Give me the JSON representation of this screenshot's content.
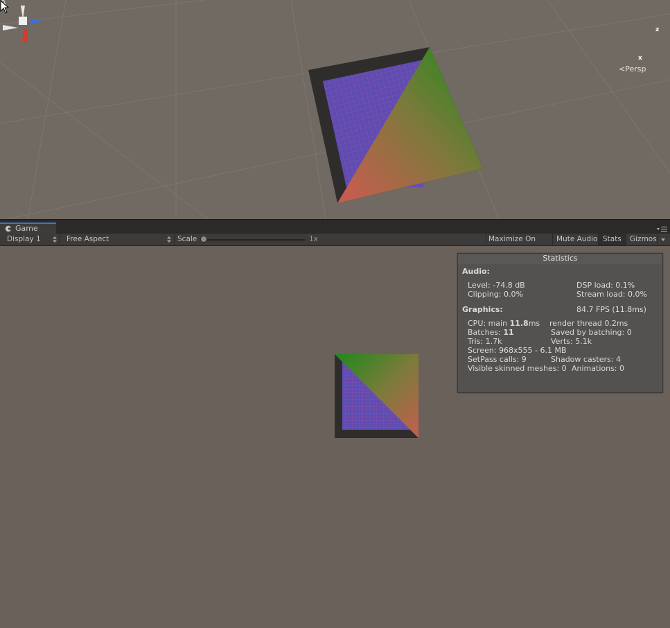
{
  "scene": {
    "persp_label": "Persp",
    "gizmo_axis_z": "z",
    "gizmo_axis_x": "x",
    "icons": [
      "lock-icon",
      "scene-gizmo-icon",
      "mouse-cursor-icon"
    ]
  },
  "tabs": [
    {
      "label": "Game",
      "icon": "game-controller-icon",
      "active": true
    }
  ],
  "toolbar": {
    "display": "Display 1",
    "aspect": "Free Aspect",
    "scale_label": "Scale",
    "scale_value": "1x",
    "scale_slider_fraction": 0,
    "maximize_on_play": "Maximize On Play",
    "mute_audio": "Mute Audio",
    "stats": "Stats",
    "gizmos": "Gizmos"
  },
  "stats": {
    "title": "Statistics",
    "audio_heading": "Audio:",
    "level": "Level: -74.8 dB",
    "dsp_load": "DSP load: 0.1%",
    "clipping": "Clipping: 0.0%",
    "stream_load": "Stream load: 0.0%",
    "graphics_heading": "Graphics:",
    "fps": "84.7 FPS (11.8ms)",
    "cpu_prefix": "CPU: main ",
    "cpu_main": "11.8",
    "cpu_unit": "ms",
    "render_thread": "render thread 0.2ms",
    "batches_prefix": "Batches: ",
    "batches": "11",
    "saved_by_batching": "Saved by batching: 0",
    "tris": "Tris: 1.7k",
    "verts": "Verts: 5.1k",
    "screen": "Screen: 968x555 - 6.1 MB",
    "setpass": "SetPass calls: 9",
    "shadow_casters": "Shadow casters: 4",
    "visible_skinned": "Visible skinned meshes: 0",
    "animations": "Animations: 0"
  },
  "colors": {
    "scene_bg": "#706a63",
    "game_bg": "#6a615b",
    "toolbar_bg": "#3c3b3a",
    "tab_accent": "#3a78c0",
    "quad_green": "#1f8a1f",
    "quad_red": "#c05a4a",
    "quad_purple": "#5a44a8"
  }
}
